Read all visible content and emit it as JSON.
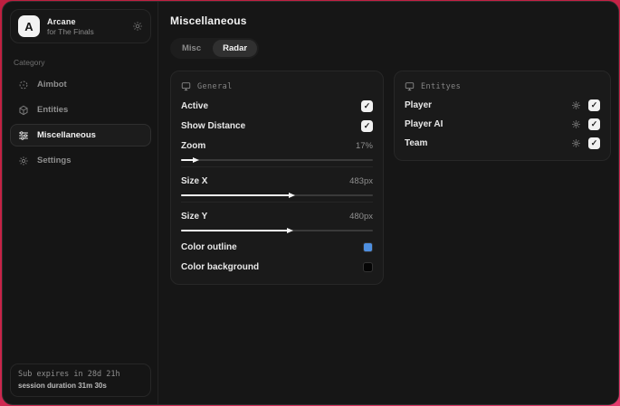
{
  "sidebar": {
    "brand": {
      "avatar_letter": "A",
      "title": "Arcane",
      "subtitle": "for The Finals"
    },
    "category_label": "Category",
    "items": [
      {
        "label": "Aimbot",
        "icon": "crosshair-icon",
        "active": false
      },
      {
        "label": "Entities",
        "icon": "cube-icon",
        "active": false
      },
      {
        "label": "Miscellaneous",
        "icon": "sliders-icon",
        "active": true
      },
      {
        "label": "Settings",
        "icon": "gear-icon",
        "active": false
      }
    ],
    "footer": {
      "sub_expiry": "Sub expires in 28d 21h",
      "session_duration": "session duration 31m 30s"
    }
  },
  "main": {
    "title": "Miscellaneous",
    "tabs": [
      {
        "label": "Misc",
        "active": false
      },
      {
        "label": "Radar",
        "active": true
      }
    ]
  },
  "general": {
    "title": "General",
    "active_label": "Active",
    "active_checked": true,
    "show_distance_label": "Show Distance",
    "show_distance_checked": true,
    "zoom_label": "Zoom",
    "zoom_value": "17%",
    "zoom_slider_percent": 7,
    "size_x_label": "Size X",
    "size_x_value": "483px",
    "size_x_slider_percent": 57,
    "size_y_label": "Size Y",
    "size_y_value": "480px",
    "size_y_slider_percent": 56,
    "color_outline_label": "Color outline",
    "color_background_label": "Color background"
  },
  "entities_panel": {
    "title": "Entityes",
    "rows": [
      {
        "label": "Player",
        "checked": true
      },
      {
        "label": "Player AI",
        "checked": true
      },
      {
        "label": "Team",
        "checked": true
      }
    ]
  },
  "colors": {
    "outline_swatch": "#4e8fe0",
    "background_swatch": "#050505",
    "backdrop_red": "#c92449",
    "accent_white": "#f5f5f5"
  }
}
